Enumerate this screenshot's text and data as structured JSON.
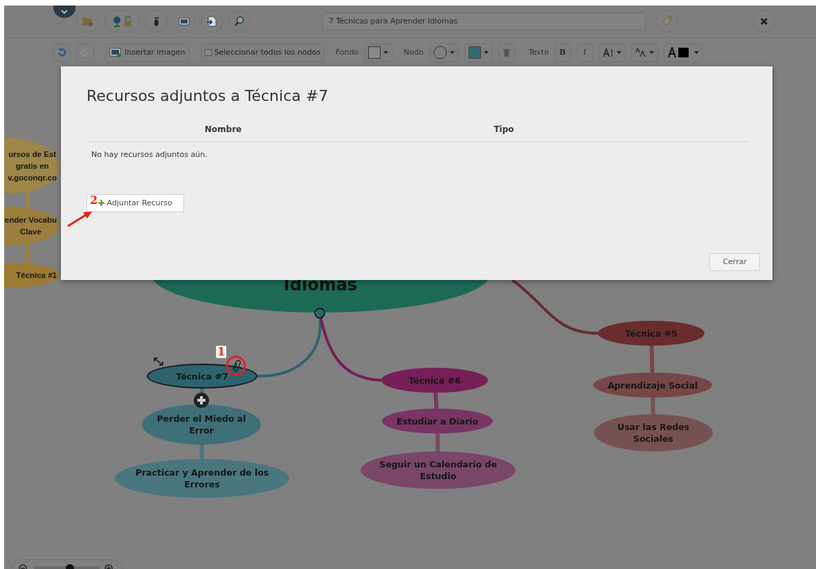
{
  "header": {
    "title": "7 Técnicas para Aprender Idiomas"
  },
  "toolbar": {
    "insert_image": "Insertar imagen",
    "select_all": {
      "label": "Seleccionar todos los nodos",
      "checked": false
    },
    "background_label": "Fondo",
    "node_label": "Nodo",
    "text_label": "Texto",
    "bold": "B",
    "italic": "I"
  },
  "mindmap": {
    "central": "Idiomas",
    "branches": [
      {
        "label": "Técnica #7",
        "color": "#2e6470",
        "selected": true,
        "children": [
          {
            "label": "Perder el Miedo al Error",
            "color": "#3f6f79",
            "selected": false,
            "children": [
              {
                "label": "Practicar y Aprender de los Errores",
                "color": "#4a767f",
                "selected": false
              }
            ]
          }
        ]
      },
      {
        "label": "Técnica #6",
        "color": "#761f58",
        "selected": false,
        "children": [
          {
            "label": "Estudiar a Diario",
            "color": "#7a3566",
            "selected": false,
            "children": [
              {
                "label": "Seguir un Calendario de Estudio",
                "color": "#7a4768",
                "selected": false
              }
            ]
          }
        ]
      },
      {
        "label": "Técnica #5",
        "color": "#6a2c2f",
        "selected": false,
        "children": [
          {
            "label": "Aprendizaje Social",
            "color": "#774649",
            "selected": false,
            "children": [
              {
                "label": "Usar las Redes\nSociales",
                "color": "#775254",
                "selected": false
              }
            ]
          }
        ]
      },
      {
        "label": "Técnica #1",
        "color": "#9c7b34",
        "selected": false,
        "children": [
          {
            "label": "ender Vocabu\nClave",
            "color": "#9c7e3f",
            "selected": false,
            "children": [
              {
                "label": "ursos de Est\ngratis en\nv.goconqr.co",
                "color": "#9e8548",
                "selected": false
              }
            ]
          }
        ]
      }
    ]
  },
  "zoom_slider": {
    "level": 0.55
  },
  "modal": {
    "title": "Recursos adjuntos a Técnica #7",
    "columns": [
      "Nombre",
      "Tipo"
    ],
    "empty_message": "No hay recursos adjuntos aún.",
    "add_button": "Adjuntar Recurso",
    "close_button": "Cerrar"
  },
  "annotations": [
    {
      "label": "1"
    },
    {
      "label": "2"
    }
  ]
}
